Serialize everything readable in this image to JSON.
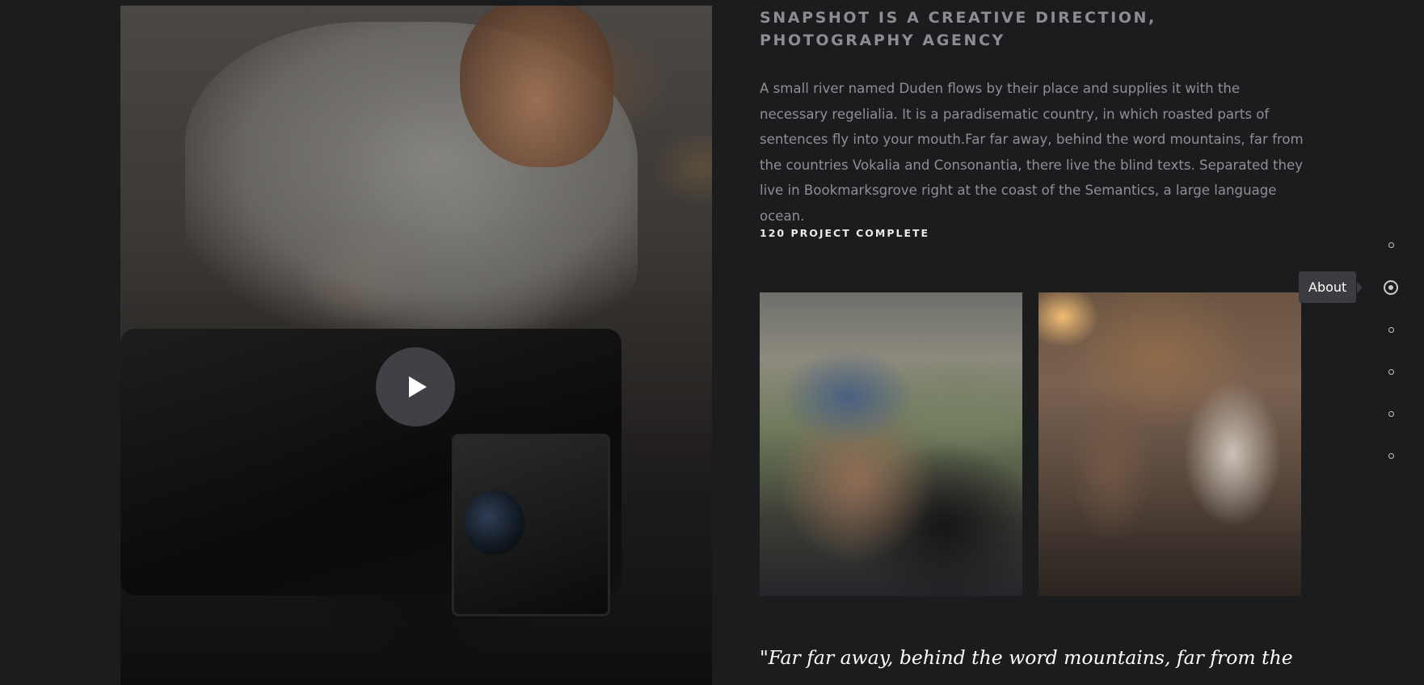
{
  "hero": {
    "image_alt": "Videographer operating a cinema camera",
    "play_icon": "play-icon"
  },
  "about": {
    "heading": "SNAPSHOT IS A CREATIVE DIRECTION, PHOTOGRAPHY AGENCY",
    "intro": "A small river named Duden flows by their place and supplies it with the necessary regelialia. It is a paradisematic country, in which roasted parts of sentences fly into your mouth.Far far away, behind the word mountains, far from the countries Vokalia and Consonantia, there live the blind texts. Separated they live in Bookmarksgrove right at the coast of the Semantics, a large language ocean.",
    "stat": "120 PROJECT COMPLETE",
    "quote": "\"Far far away, behind the word mountains, far from the"
  },
  "gallery": [
    {
      "alt": "Camera operator in a blue cap filming outdoors"
    },
    {
      "alt": "Crew filming people in a warmly lit room"
    }
  ],
  "dot_nav": {
    "tooltip": "About",
    "active_index": 1,
    "items": [
      "",
      "About",
      "",
      "",
      "",
      ""
    ]
  }
}
